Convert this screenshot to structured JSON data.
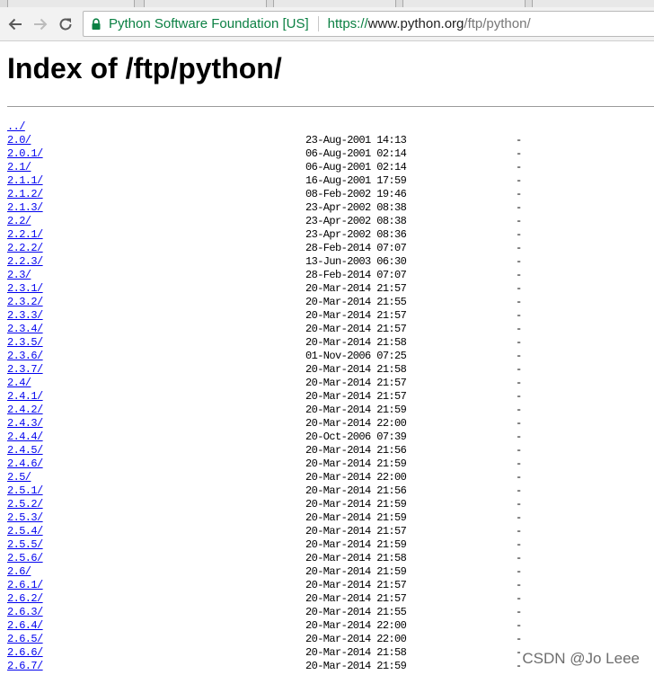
{
  "browser": {
    "security_label": "Python Software Foundation [US]",
    "url_scheme": "https://",
    "url_host": "www.python.org",
    "url_path": "/ftp/python/"
  },
  "page": {
    "title": "Index of /ftp/python/",
    "parent_link": "../"
  },
  "listing": [
    {
      "name": "2.0/",
      "date": "23-Aug-2001 14:13",
      "size": "-"
    },
    {
      "name": "2.0.1/",
      "date": "06-Aug-2001 02:14",
      "size": "-"
    },
    {
      "name": "2.1/",
      "date": "06-Aug-2001 02:14",
      "size": "-"
    },
    {
      "name": "2.1.1/",
      "date": "16-Aug-2001 17:59",
      "size": "-"
    },
    {
      "name": "2.1.2/",
      "date": "08-Feb-2002 19:46",
      "size": "-"
    },
    {
      "name": "2.1.3/",
      "date": "23-Apr-2002 08:38",
      "size": "-"
    },
    {
      "name": "2.2/",
      "date": "23-Apr-2002 08:38",
      "size": "-"
    },
    {
      "name": "2.2.1/",
      "date": "23-Apr-2002 08:36",
      "size": "-"
    },
    {
      "name": "2.2.2/",
      "date": "28-Feb-2014 07:07",
      "size": "-"
    },
    {
      "name": "2.2.3/",
      "date": "13-Jun-2003 06:30",
      "size": "-"
    },
    {
      "name": "2.3/",
      "date": "28-Feb-2014 07:07",
      "size": "-"
    },
    {
      "name": "2.3.1/",
      "date": "20-Mar-2014 21:57",
      "size": "-"
    },
    {
      "name": "2.3.2/",
      "date": "20-Mar-2014 21:55",
      "size": "-"
    },
    {
      "name": "2.3.3/",
      "date": "20-Mar-2014 21:57",
      "size": "-"
    },
    {
      "name": "2.3.4/",
      "date": "20-Mar-2014 21:57",
      "size": "-"
    },
    {
      "name": "2.3.5/",
      "date": "20-Mar-2014 21:58",
      "size": "-"
    },
    {
      "name": "2.3.6/",
      "date": "01-Nov-2006 07:25",
      "size": "-"
    },
    {
      "name": "2.3.7/",
      "date": "20-Mar-2014 21:58",
      "size": "-"
    },
    {
      "name": "2.4/",
      "date": "20-Mar-2014 21:57",
      "size": "-"
    },
    {
      "name": "2.4.1/",
      "date": "20-Mar-2014 21:57",
      "size": "-"
    },
    {
      "name": "2.4.2/",
      "date": "20-Mar-2014 21:59",
      "size": "-"
    },
    {
      "name": "2.4.3/",
      "date": "20-Mar-2014 22:00",
      "size": "-"
    },
    {
      "name": "2.4.4/",
      "date": "20-Oct-2006 07:39",
      "size": "-"
    },
    {
      "name": "2.4.5/",
      "date": "20-Mar-2014 21:56",
      "size": "-"
    },
    {
      "name": "2.4.6/",
      "date": "20-Mar-2014 21:59",
      "size": "-"
    },
    {
      "name": "2.5/",
      "date": "20-Mar-2014 22:00",
      "size": "-"
    },
    {
      "name": "2.5.1/",
      "date": "20-Mar-2014 21:56",
      "size": "-"
    },
    {
      "name": "2.5.2/",
      "date": "20-Mar-2014 21:59",
      "size": "-"
    },
    {
      "name": "2.5.3/",
      "date": "20-Mar-2014 21:59",
      "size": "-"
    },
    {
      "name": "2.5.4/",
      "date": "20-Mar-2014 21:57",
      "size": "-"
    },
    {
      "name": "2.5.5/",
      "date": "20-Mar-2014 21:59",
      "size": "-"
    },
    {
      "name": "2.5.6/",
      "date": "20-Mar-2014 21:58",
      "size": "-"
    },
    {
      "name": "2.6/",
      "date": "20-Mar-2014 21:59",
      "size": "-"
    },
    {
      "name": "2.6.1/",
      "date": "20-Mar-2014 21:57",
      "size": "-"
    },
    {
      "name": "2.6.2/",
      "date": "20-Mar-2014 21:57",
      "size": "-"
    },
    {
      "name": "2.6.3/",
      "date": "20-Mar-2014 21:55",
      "size": "-"
    },
    {
      "name": "2.6.4/",
      "date": "20-Mar-2014 22:00",
      "size": "-"
    },
    {
      "name": "2.6.5/",
      "date": "20-Mar-2014 22:00",
      "size": "-"
    },
    {
      "name": "2.6.6/",
      "date": "20-Mar-2014 21:58",
      "size": "-"
    },
    {
      "name": "2.6.7/",
      "date": "20-Mar-2014 21:59",
      "size": "-"
    }
  ],
  "watermark": "CSDN @Jo Leee",
  "colors": {
    "link": "#0000ee",
    "secure_green": "#0b8043"
  },
  "icons": {
    "back": "back-arrow-icon",
    "forward": "forward-arrow-icon",
    "reload": "reload-icon",
    "lock": "lock-icon",
    "favicon": "favicon-icon"
  }
}
